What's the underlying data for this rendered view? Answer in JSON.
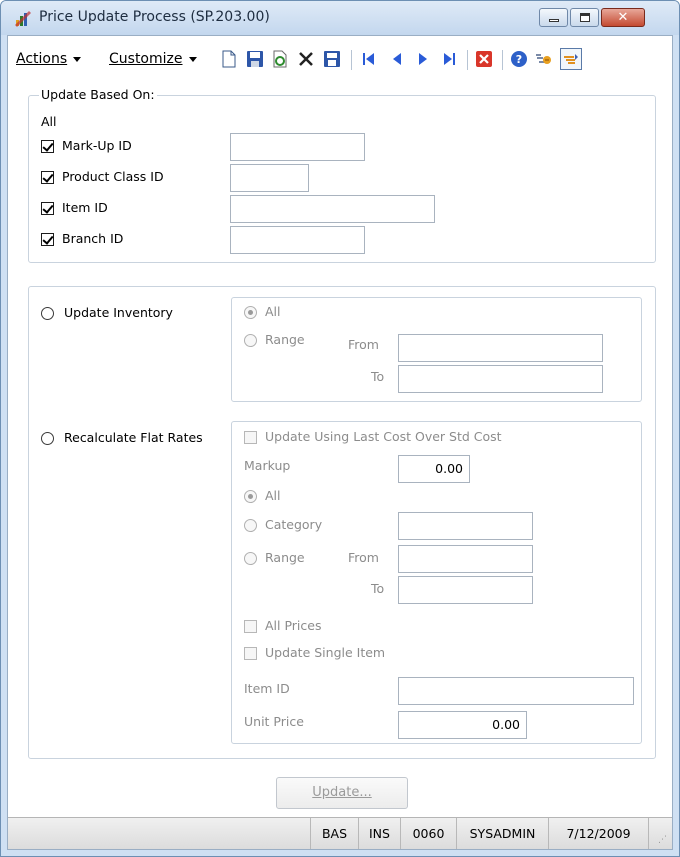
{
  "window": {
    "title": "Price Update Process (SP.203.00)"
  },
  "menu": {
    "actions": "Actions",
    "customize": "Customize"
  },
  "update_based_on": {
    "legend": "Update Based On:",
    "all_label": "All",
    "fields": [
      {
        "label": "Mark-Up ID",
        "checked": true,
        "value": ""
      },
      {
        "label": "Product Class ID",
        "checked": true,
        "value": ""
      },
      {
        "label": "Item ID",
        "checked": true,
        "value": ""
      },
      {
        "label": "Branch ID",
        "checked": true,
        "value": ""
      }
    ]
  },
  "update_inventory": {
    "label": "Update Inventory",
    "all_label": "All",
    "range_label": "Range",
    "from_label": "From",
    "to_label": "To",
    "from_value": "",
    "to_value": ""
  },
  "recalc": {
    "label": "Recalculate Flat Rates",
    "use_last_cost_label": "Update Using Last Cost Over Std Cost",
    "markup_label": "Markup",
    "markup_value": "0.00",
    "all_label": "All",
    "category_label": "Category",
    "category_value": "",
    "range_label": "Range",
    "from_label": "From",
    "to_label": "To",
    "from_value": "",
    "to_value": "",
    "all_prices_label": "All Prices",
    "single_item_label": "Update Single Item",
    "item_id_label": "Item ID",
    "item_id_value": "",
    "unit_price_label": "Unit Price",
    "unit_price_value": "0.00"
  },
  "update_button": "Update...",
  "status": {
    "mode": "BAS",
    "ins": "INS",
    "company": "0060",
    "user": "SYSADMIN",
    "date": "7/12/2009"
  },
  "colors": {
    "titlebar": "#c3d7ee",
    "close_button": "#c44a31",
    "panel_border": "#c9d3de"
  }
}
